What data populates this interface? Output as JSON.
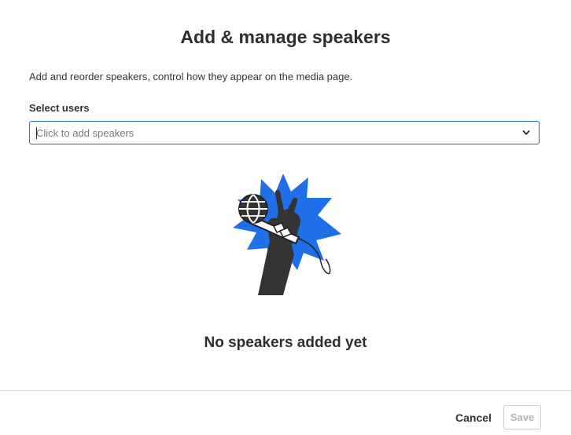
{
  "dialog": {
    "title": "Add & manage speakers",
    "description": "Add and reorder speakers, control how they appear on the media page."
  },
  "select_users": {
    "label": "Select users",
    "placeholder": "Click to add speakers",
    "value": "",
    "dropdown_icon": "chevron-down-icon"
  },
  "empty_state": {
    "illustration": "hand-holding-microphone-illustration",
    "message": "No speakers added yet",
    "accent_color": "#1e6fe8"
  },
  "footer": {
    "cancel_label": "Cancel",
    "save_label": "Save",
    "save_enabled": false
  },
  "colors": {
    "focus_border": "#1b6fc4",
    "text": "#2e2e2e",
    "disabled_text": "#b5b5b5"
  }
}
